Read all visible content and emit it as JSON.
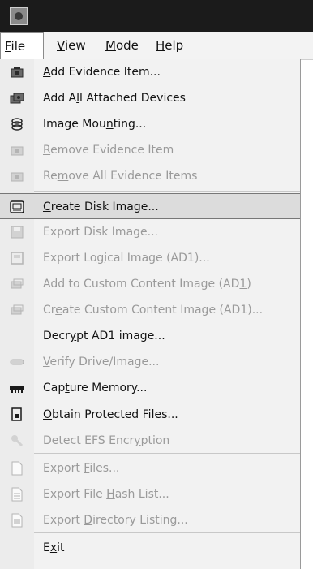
{
  "menubar": {
    "items": [
      "File",
      "View",
      "Mode",
      "Help"
    ],
    "mnemonic": [
      "F",
      "V",
      "M",
      "H"
    ]
  },
  "menu": {
    "items": [
      {
        "label": "Add Evidence Item...",
        "mn": "A",
        "icon": "evidence-add-icon",
        "disabled": false
      },
      {
        "label": "Add All Attached Devices",
        "mn": "l",
        "icon": "devices-add-icon",
        "disabled": false
      },
      {
        "label": "Image Mounting...",
        "mn": "n",
        "icon": "mount-icon",
        "disabled": false
      },
      {
        "label": "Remove Evidence Item",
        "mn": "R",
        "icon": "evidence-remove-icon",
        "disabled": true
      },
      {
        "label": "Remove All Evidence Items",
        "mn": "m",
        "icon": "evidence-remove-all-icon",
        "disabled": true
      },
      {
        "label": "Create Disk Image...",
        "mn": "C",
        "icon": "disk-image-icon",
        "disabled": false,
        "highlight": true
      },
      {
        "label": "Export Disk Image...",
        "mn": "",
        "icon": "export-disk-icon",
        "disabled": true
      },
      {
        "label": "Export Logical Image (AD1)...",
        "mn": "g",
        "icon": "logical-image-icon",
        "disabled": true
      },
      {
        "label": "Add to Custom Content Image (AD1)",
        "mn": "1",
        "icon": "custom-content-add-icon",
        "disabled": true
      },
      {
        "label": "Create Custom Content Image (AD1)...",
        "mn": "e",
        "icon": "custom-content-create-icon",
        "disabled": true
      },
      {
        "label": "Decrypt AD1 image...",
        "mn": "y",
        "icon": "",
        "disabled": false
      },
      {
        "label": "Verify Drive/Image...",
        "mn": "V",
        "icon": "verify-drive-icon",
        "disabled": true
      },
      {
        "label": "Capture Memory...",
        "mn": "t",
        "icon": "memory-icon",
        "disabled": false
      },
      {
        "label": "Obtain Protected Files...",
        "mn": "O",
        "icon": "protected-files-icon",
        "disabled": false
      },
      {
        "label": "Detect EFS Encryption",
        "mn": "y",
        "icon": "detect-efs-icon",
        "disabled": true
      },
      {
        "label": "Export Files...",
        "mn": "F",
        "icon": "export-files-icon",
        "disabled": true
      },
      {
        "label": "Export File Hash List...",
        "mn": "H",
        "icon": "hash-list-icon",
        "disabled": true
      },
      {
        "label": "Export Directory Listing...",
        "mn": "D",
        "icon": "directory-listing-icon",
        "disabled": true
      },
      {
        "label": "Exit",
        "mn": "x",
        "icon": "",
        "disabled": false
      }
    ]
  },
  "colors": {
    "titlebar": "#1b1b1b",
    "menu_bg": "#f2f2f2",
    "highlight": "#dcdcdc",
    "disabled_text": "#9a9a9a"
  }
}
